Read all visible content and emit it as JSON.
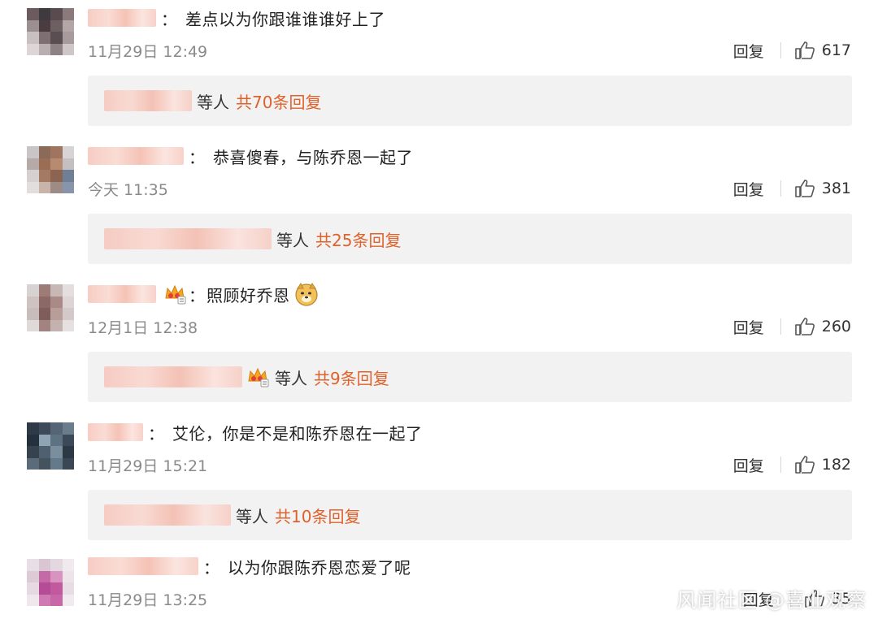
{
  "comments": [
    {
      "text": "差点以为你跟谁谁谁好上了",
      "time": "11月29日 12:49",
      "reply_label": "回复",
      "likes": "617",
      "thread": {
        "who": "等人",
        "count": "共70条回复"
      }
    },
    {
      "text": "恭喜傻春，与陈乔恩一起了",
      "time": "今天 11:35",
      "reply_label": "回复",
      "likes": "381",
      "thread": {
        "who": "等人",
        "count": "共25条回复"
      }
    },
    {
      "text": "照顾好乔恩",
      "time": "12月1日 12:38",
      "reply_label": "回复",
      "likes": "260",
      "thread": {
        "who": "等人",
        "count": "共9条回复"
      }
    },
    {
      "text": "艾伦，你是不是和陈乔恩在一起了",
      "time": "11月29日 15:21",
      "reply_label": "回复",
      "likes": "182",
      "thread": {
        "who": "等人",
        "count": "共10条回复"
      }
    },
    {
      "text": "以为你跟陈乔恩恋爱了呢",
      "time": "11月29日 13:25",
      "reply_label": "回复",
      "likes": "35"
    }
  ],
  "colon": "：",
  "watermark": "风闻社区 @喜业观察",
  "colors": {
    "accent": "#e0612b",
    "reply_bg": "#f2f2f2",
    "time": "#8a8a8a"
  }
}
